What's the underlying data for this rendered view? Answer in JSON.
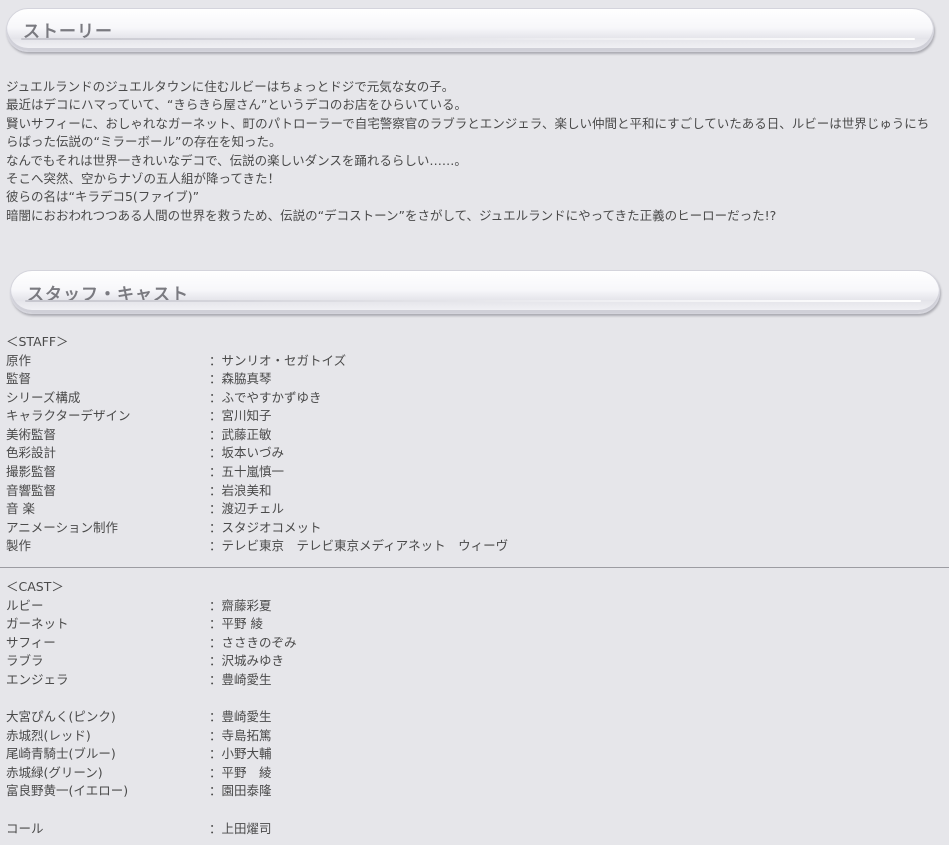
{
  "story": {
    "title": "ストーリー",
    "lines": [
      "ジュエルランドのジュエルタウンに住むルビーはちょっとドジで元気な女の子。",
      "最近はデコにハマっていて、“きらきら屋さん”というデコのお店をひらいている。",
      "賢いサフィーに、おしゃれなガーネット、町のパトローラーで自宅警察官のラブラとエンジェラ、楽しい仲間と平和にすごしていたある日、ルビーは世界じゅうにちらばった伝説の“ミラーボール”の存在を知った。",
      "なんでもそれは世界一きれいなデコで、伝説の楽しいダンスを踊れるらしい……。",
      "そこへ突然、空からナゾの五人組が降ってきた！",
      "彼らの名は“キラデコ5(ファイブ)”",
      "暗闇におおわれつつある人間の世界を救うため、伝説の“デコストーン”をさがして、ジュエルランドにやってきた正義のヒーローだった!?"
    ]
  },
  "staff_cast": {
    "title": "スタッフ・キャスト",
    "staff_heading": "＜STAFF＞",
    "staff": [
      {
        "role": "原作",
        "name": "：サンリオ・セガトイズ"
      },
      {
        "role": "監督",
        "name": "：森脇真琴"
      },
      {
        "role": "シリーズ構成",
        "name": "：ふでやすかずゆき"
      },
      {
        "role": "キャラクターデザイン",
        "name": "：宮川知子"
      },
      {
        "role": "美術監督",
        "name": "：武藤正敏"
      },
      {
        "role": "色彩設計",
        "name": "：坂本いづみ"
      },
      {
        "role": "撮影監督",
        "name": "：五十嵐慎一"
      },
      {
        "role": "音響監督",
        "name": "：岩浪美和"
      },
      {
        "role": "音 楽",
        "name": "：渡辺チェル"
      },
      {
        "role": "アニメーション制作",
        "name": "：スタジオコメット"
      },
      {
        "role": "製作",
        "name": "：テレビ東京　テレビ東京メディアネット　ウィーヴ"
      }
    ],
    "cast_heading": "＜CAST＞",
    "cast_group1": [
      {
        "role": "ルビー",
        "name": "：齋藤彩夏"
      },
      {
        "role": "ガーネット",
        "name": "：平野 綾"
      },
      {
        "role": "サフィー",
        "name": "：ささきのぞみ"
      },
      {
        "role": "ラブラ",
        "name": "：沢城みゆき"
      },
      {
        "role": "エンジェラ",
        "name": "：豊崎愛生"
      }
    ],
    "cast_group2": [
      {
        "role": "大宮ぴんく(ピンク)",
        "name": "：豊崎愛生"
      },
      {
        "role": "赤城烈(レッド)",
        "name": "：寺島拓篤"
      },
      {
        "role": "尾崎青騎士(ブルー)",
        "name": "：小野大輔"
      },
      {
        "role": "赤城緑(グリーン)",
        "name": "：平野　綾"
      },
      {
        "role": "富良野黄一(イエロー)",
        "name": "：園田泰隆"
      }
    ],
    "cast_group3": [
      {
        "role": "コール",
        "name": "：上田燿司"
      }
    ]
  }
}
